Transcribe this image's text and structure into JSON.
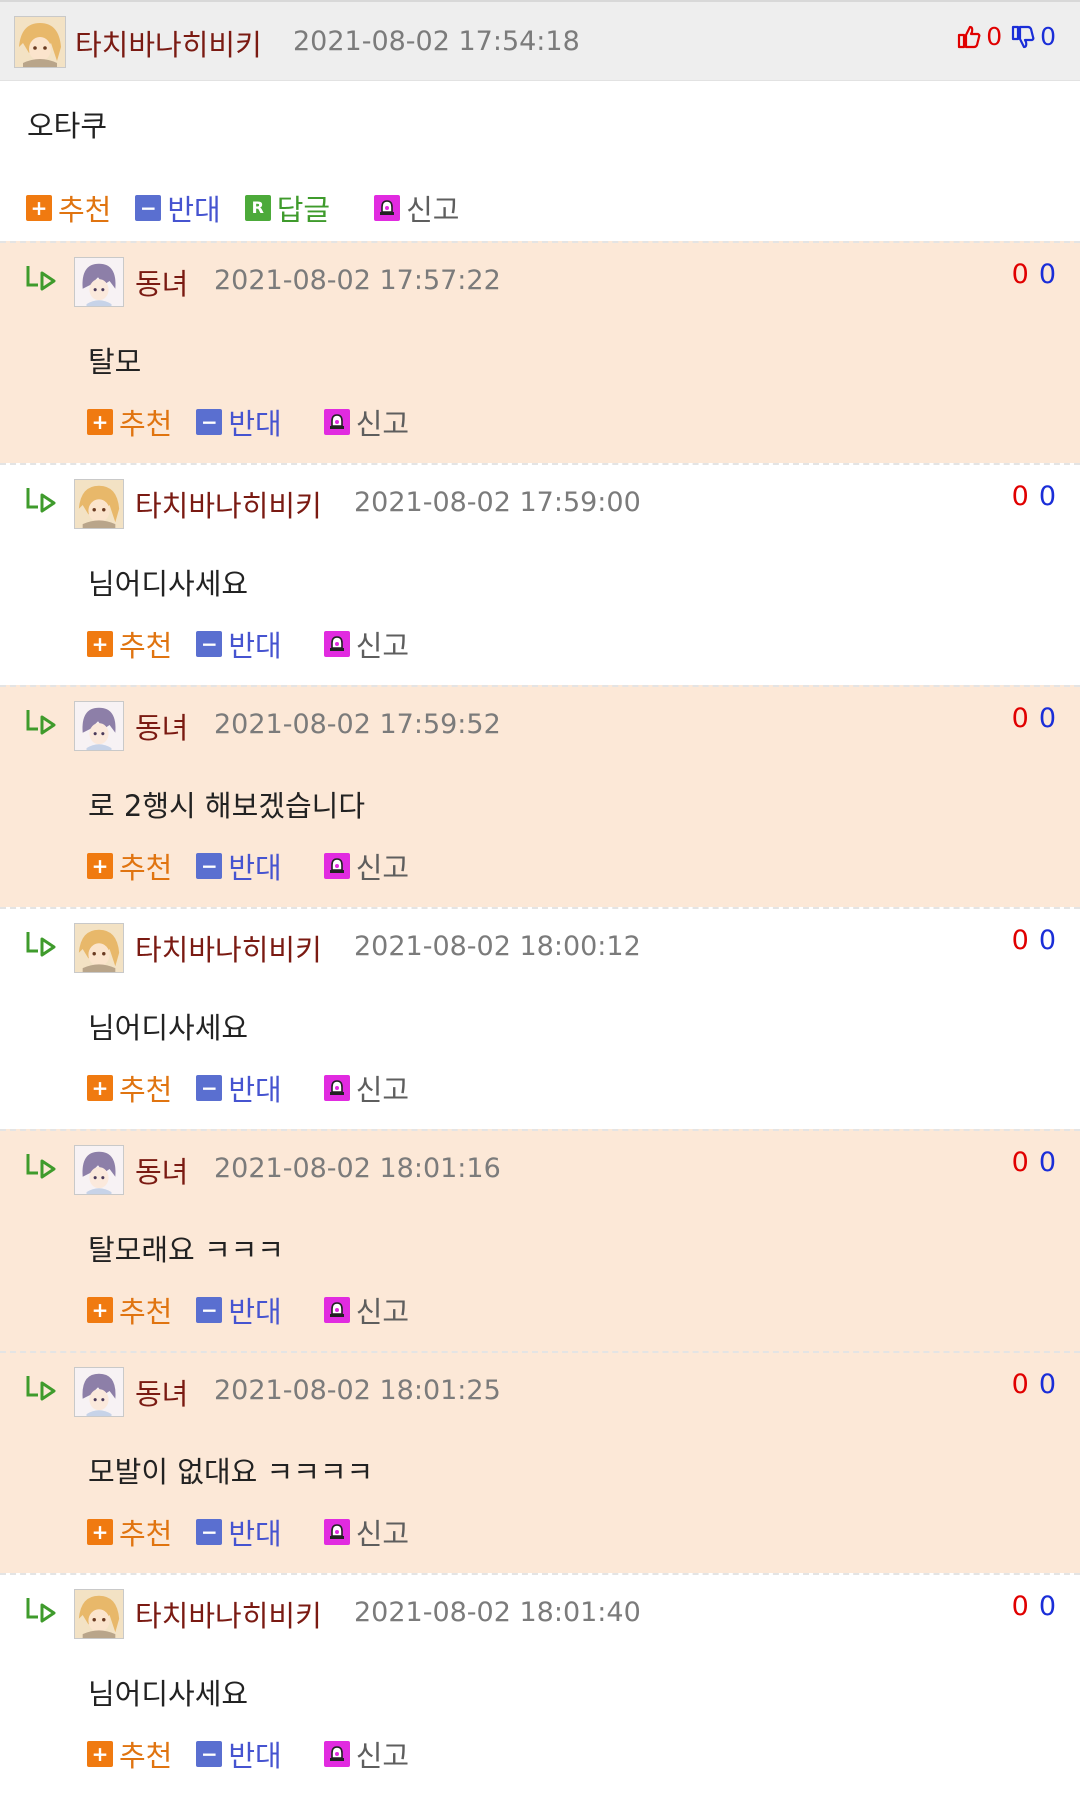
{
  "top_comment": {
    "nickname": "타치바나히비키",
    "date": "2021-08-02 17:54:18",
    "likes": "0",
    "dislikes": "0",
    "text": "오타쿠",
    "actions": {
      "recommend": "추천",
      "oppose": "반대",
      "reply": "답글",
      "report": "신고"
    }
  },
  "replies": [
    {
      "nickname": "동녀",
      "date": "2021-08-02 17:57:22",
      "up": "0",
      "down": "0",
      "text": "탈모",
      "avatar": "purple-hair-avatar"
    },
    {
      "nickname": "타치바나히비키",
      "date": "2021-08-02 17:59:00",
      "up": "0",
      "down": "0",
      "text": "님어디사세요",
      "avatar": "blonde-hair-avatar"
    },
    {
      "nickname": "동녀",
      "date": "2021-08-02 17:59:52",
      "up": "0",
      "down": "0",
      "text": "로 2행시 해보겠습니다",
      "avatar": "purple-hair-avatar"
    },
    {
      "nickname": "타치바나히비키",
      "date": "2021-08-02 18:00:12",
      "up": "0",
      "down": "0",
      "text": "님어디사세요",
      "avatar": "blonde-hair-avatar"
    },
    {
      "nickname": "동녀",
      "date": "2021-08-02 18:01:16",
      "up": "0",
      "down": "0",
      "text": "탈모래요 ㅋㅋㅋ",
      "avatar": "purple-hair-avatar"
    },
    {
      "nickname": "동녀",
      "date": "2021-08-02 18:01:25",
      "up": "0",
      "down": "0",
      "text": "모발이 없대요 ㅋㅋㅋㅋ",
      "avatar": "purple-hair-avatar"
    },
    {
      "nickname": "타치바나히비키",
      "date": "2021-08-02 18:01:40",
      "up": "0",
      "down": "0",
      "text": "님어디사세요",
      "avatar": "blonde-hair-avatar"
    }
  ],
  "reply_actions": {
    "recommend": "추천",
    "oppose": "반대",
    "report": "신고"
  },
  "colors": {
    "shaded_row": "#fce8d7",
    "nickname": "#7a1a12",
    "up_vote": "#e00000",
    "down_vote": "#1a2ed8"
  }
}
